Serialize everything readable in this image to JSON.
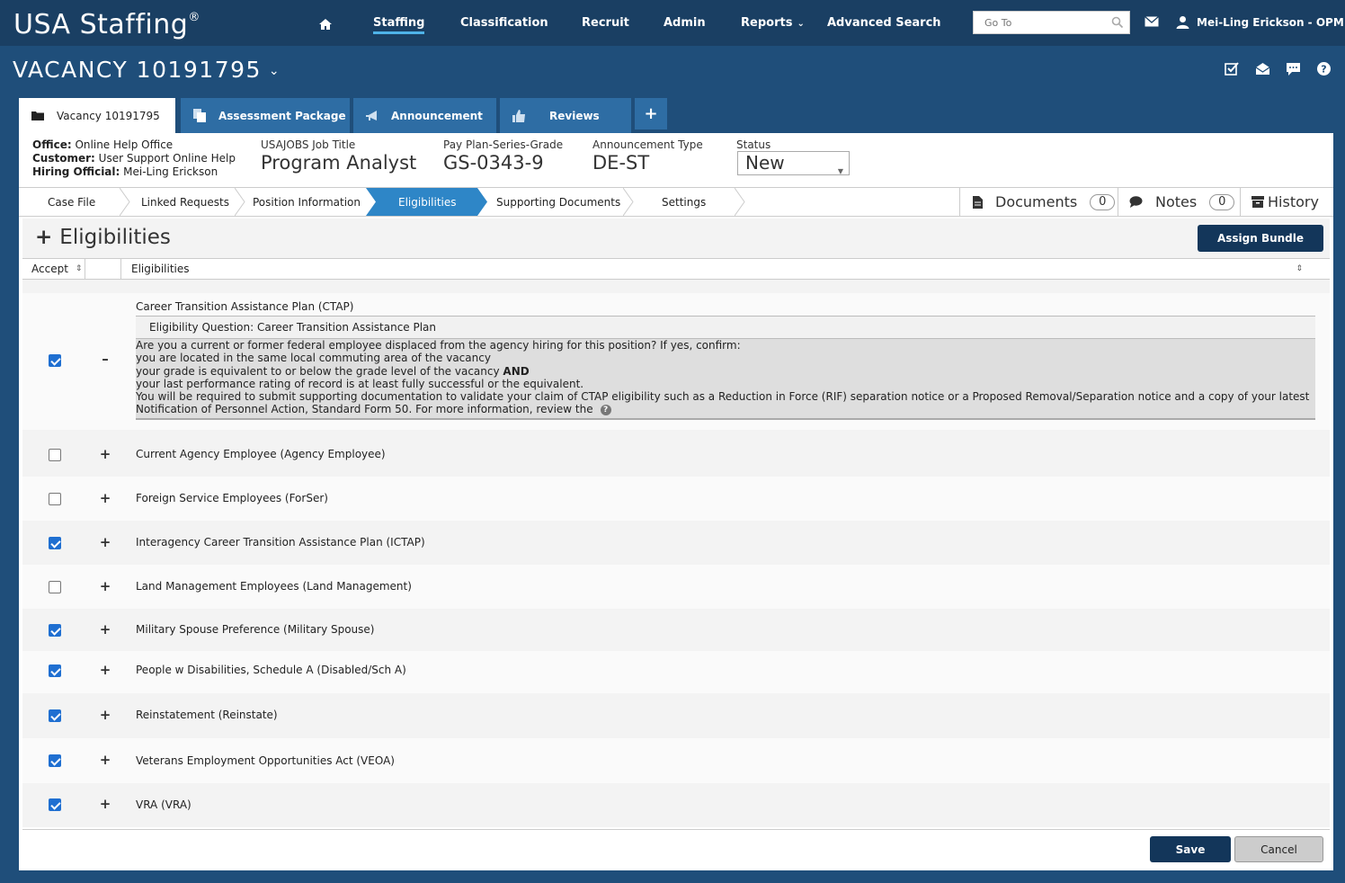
{
  "app": {
    "brand": "USA Staffing",
    "brand_mark": "®"
  },
  "topnav": {
    "items": [
      {
        "label": "Staffing"
      },
      {
        "label": "Classification"
      },
      {
        "label": "Recruit"
      },
      {
        "label": "Admin"
      },
      {
        "label": "Reports"
      },
      {
        "label": "Advanced Search"
      }
    ],
    "goto_placeholder": "Go To",
    "user": "Mei-Ling Erickson - OPM"
  },
  "vacancy": {
    "title": "VACANCY 10191795"
  },
  "tabs": [
    {
      "label": "Vacancy 10191795",
      "icon": "folder-icon"
    },
    {
      "label": "Assessment Package",
      "icon": "documents-icon"
    },
    {
      "label": "Announcement",
      "icon": "megaphone-icon"
    },
    {
      "label": "Reviews",
      "icon": "thumbs-up-icon"
    }
  ],
  "info": {
    "office_label": "Office:",
    "office": "Online Help Office",
    "customer_label": "Customer:",
    "customer": "User Support Online Help",
    "hiring_label": "Hiring Official:",
    "hiring": "Mei-Ling Erickson",
    "job_title_label": "USAJOBS Job Title",
    "job_title": "Program Analyst",
    "ppsg_label": "Pay Plan-Series-Grade",
    "ppsg": "GS-0343-9",
    "ann_type_label": "Announcement Type",
    "ann_type": "DE-ST",
    "status_label": "Status",
    "status": "New"
  },
  "subnav": {
    "steps": [
      "Case File",
      "Linked Requests",
      "Position Information",
      "Eligibilities",
      "Supporting Documents",
      "Settings"
    ],
    "active": "Eligibilities",
    "documents_label": "Documents",
    "documents_count": "0",
    "notes_label": "Notes",
    "notes_count": "0",
    "history_label": "History"
  },
  "section": {
    "title": "Eligibilities",
    "assign_button": "Assign Bundle",
    "col_accept": "Accept",
    "col_eligibilities": "Eligibilities"
  },
  "rows": [
    {
      "label": "Career Transition Assistance Plan (CTAP)",
      "checked": true,
      "expanded": true
    },
    {
      "label": "Current Agency Employee (Agency Employee)",
      "checked": false
    },
    {
      "label": "Foreign Service Employees (ForSer)",
      "checked": false
    },
    {
      "label": "Interagency Career Transition Assistance Plan (ICTAP)",
      "checked": true
    },
    {
      "label": "Land Management Employees (Land Management)",
      "checked": false
    },
    {
      "label": "Military Spouse Preference (Military Spouse)",
      "checked": true
    },
    {
      "label": "People w Disabilities, Schedule A (Disabled/Sch A)",
      "checked": true
    },
    {
      "label": "Reinstatement (Reinstate)",
      "checked": true
    },
    {
      "label": "Veterans Employment Opportunities Act (VEOA)",
      "checked": true
    },
    {
      "label": "VRA (VRA)",
      "checked": true
    }
  ],
  "question": {
    "title": "Eligibility Question: Career Transition Assistance Plan",
    "line1": "Are you a current or former federal employee displaced from the agency hiring for this position? If yes, confirm:",
    "line2": "you are located in the same local commuting area of the vacancy",
    "line3a": "your grade is equivalent to or below the grade level of the vacancy ",
    "line3b": "AND",
    "line4": "your last performance rating of record is at least fully successful or the equivalent.",
    "line5": "You will be required to submit supporting documentation to validate your claim of CTAP eligibility such as a Reduction in Force (RIF) separation notice or a Proposed Removal/Separation notice and a copy of your latest",
    "line6": "Notification of Personnel Action, Standard Form 50. For more information, review the"
  },
  "footer": {
    "save": "Save",
    "cancel": "Cancel"
  },
  "colors": {
    "nav_bg": "#1a3f63",
    "header_bg": "#1f4e7a",
    "tab_bg": "#2e6da4",
    "active_step": "#2e86c7",
    "primary_button": "#13365a",
    "checkbox": "#1f6fd1"
  }
}
